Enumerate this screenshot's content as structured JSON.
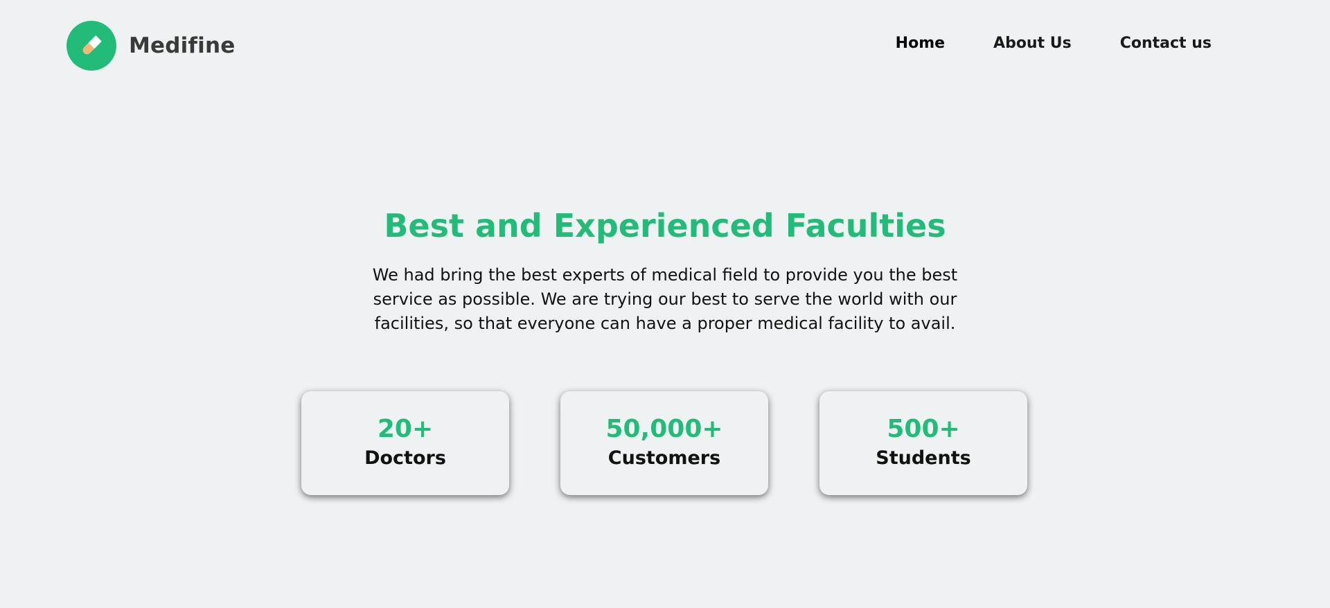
{
  "brand": {
    "name": "Medifine",
    "icon": "pill-icon",
    "color": "#22bb7a"
  },
  "nav": {
    "items": [
      {
        "label": "Home",
        "active": true
      },
      {
        "label": "About Us",
        "active": false
      },
      {
        "label": "Contact us",
        "active": false
      }
    ]
  },
  "hero": {
    "title": "Best and Experienced Faculties",
    "description": "We had bring the best experts of medical field to provide you the best service as possible. We are trying our best to serve the world with our facilities, so that everyone can have a proper medical facility to avail."
  },
  "stats": [
    {
      "value": "20+",
      "label": "Doctors"
    },
    {
      "value": "50,000+",
      "label": "Customers"
    },
    {
      "value": "500+",
      "label": "Students"
    }
  ],
  "colors": {
    "accent": "#22bb7a",
    "background": "#eff2f3",
    "pill_light": "#ffffff",
    "pill_dark": "#f6b877"
  }
}
